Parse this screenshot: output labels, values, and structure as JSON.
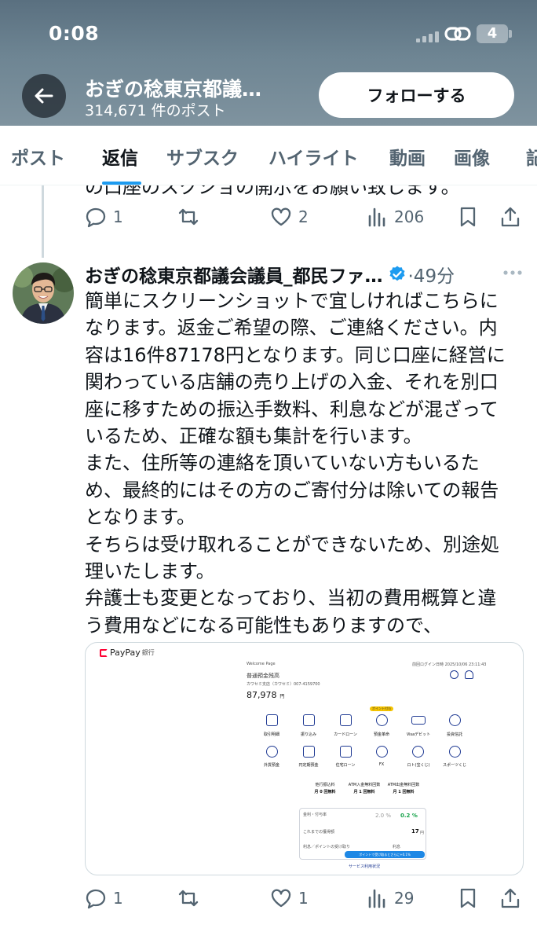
{
  "status_bar": {
    "time": "0:08",
    "battery_level": "4"
  },
  "header": {
    "title": "おぎの稔東京都議…",
    "post_count": "314,671 件のポスト",
    "follow_label": "フォローする"
  },
  "tabs": [
    {
      "label": "ポスト",
      "active": false
    },
    {
      "label": "返信",
      "active": true
    },
    {
      "label": "サブスク",
      "active": false
    },
    {
      "label": "ハイライト",
      "active": false
    },
    {
      "label": "動画",
      "active": false
    },
    {
      "label": "画像",
      "active": false
    },
    {
      "label": "記",
      "active": false
    }
  ],
  "previous_tweet": {
    "cut_text": "の口座のスクショの開示をお願い致します。",
    "reply_count": "1",
    "retweet_count": "",
    "like_count": "2",
    "view_count": "206"
  },
  "tweet": {
    "author_name": "おぎの稔東京都議会議員_都民ファ…",
    "time": "·49分",
    "lines": [
      "簡単にスクリーンショットで宜しければこちらに",
      "なります。返金ご希望の際、ご連絡ください。内",
      "容は16件87178円となります。同じ口座に経営に",
      "関わっている店舗の売り上げの入金、それを別口",
      "座に移すための振込手数料、利息などが混ざって",
      "いるため、正確な額も集計を行います。",
      "また、住所等の連絡を頂いていない方もいるた",
      "め、最終的にはその方のご寄付分は除いての報告",
      "となります。",
      "そちらは受け取れることができないため、別途処",
      "理いたします。",
      "弁護士も変更となっており、当初の費用概算と違",
      "う費用などになる可能性もありますので、"
    ],
    "reply_count": "1",
    "retweet_count": "",
    "like_count": "1",
    "view_count": "29"
  },
  "media": {
    "brand": "PayPay",
    "brand_sub": "銀行",
    "welcome": "Welcome Page",
    "last_login": "前回ログイン日時  2025/10/06 23:11:43",
    "account_title": "普通預金残高",
    "account_holder": "カワセミ支店（カワセミ）007-4159700",
    "balance": "87,978",
    "balance_unit": "円",
    "badge": "ポイント付与",
    "menu_row1": [
      "取引明細",
      "振り込み",
      "カードローン",
      "預金革命",
      "Visaデビット",
      "投資信託"
    ],
    "menu_row2": [
      "外貨預金",
      "円定期預金",
      "住宅ローン",
      "FX",
      "ロト(宝くじ)",
      "スポーツくじ"
    ],
    "fee_labels": [
      "他行振込料",
      "ATM入金無料回数",
      "ATM出金無料回数"
    ],
    "fee_values": [
      "月 0 回無料",
      "月 1 回無料",
      "月 1 回無料"
    ],
    "rate_label": "金利・付与率",
    "rate_values": [
      "2.0 %",
      "0.2 %"
    ],
    "received_label": "これまでの獲得額",
    "received_value": "17",
    "received_unit": "円",
    "interest_label": "利息／ポイントの受け取り",
    "interest_option": "利息",
    "point_button": "ポイントで受け取るとさらに+0.1%",
    "footer_link": "サービス利用状況"
  },
  "colors": {
    "accent": "#1d9bf0",
    "text": "#0f1419",
    "secondary": "#536471",
    "header_bg": "#6e8593"
  }
}
